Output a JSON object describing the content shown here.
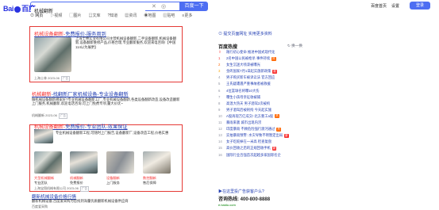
{
  "header": {
    "logo_text": "Bai",
    "logo_text2": "百度",
    "query": "机械翻新",
    "search_button": "百度一下",
    "settings": "百度首页",
    "setting_link": "设置",
    "login": "登录"
  },
  "tabs": [
    {
      "label": "网页"
    },
    {
      "label": "视频"
    },
    {
      "label": "图片"
    },
    {
      "label": "文库"
    },
    {
      "label": "知道"
    },
    {
      "label": "资讯"
    },
    {
      "label": "地图"
    },
    {
      "label": "贴吧"
    },
    {
      "label": "更多"
    }
  ],
  "info_line": "百度为您找到相关结果约100,000,000个",
  "results": {
    "r1": {
      "title_a": "机械设备翻新-",
      "title_b": "免费报价-服务周到",
      "text": "上海士林实业有限公司主营机械设备翻新,二手设备翻新,机械设备翻新,设备翻新维修产品,价格合理,专业翻新服务,欢迎来电咨询!【中国114以为展更】",
      "meta": "上海士林 2023-06",
      "ad": "广告"
    },
    "r2": {
      "title_a": "机械翻新",
      "title_b": "-找翻新厂家机械设备-专业设备翻新",
      "text": "做机械设备翻新哪家好?专业机械设备翻新工厂,专业机械设备翻新,各类设备翻新改造,设备改造翻新上门服务,机械翻新,欢迎电话咨询,可上门免费专项,量大价优~",
      "meta": "机械翻新 2023-06",
      "ad": "广告"
    },
    "r3": {
      "title_a": "机械设备翻新-",
      "title_b": "免费报价-专业团队-效果保证",
      "text": "专业机械设备翻新工程,可随时上门报告,设备翻新厂,设备改造工程,价格实惠",
      "items": [
        {
          "cap_a": "大型",
          "cap_b": "机械翻新",
          "sub": "专业团队"
        },
        {
          "cap_a": "机械",
          "cap_b": "翻新",
          "sub": "免费报价"
        },
        {
          "cap_a": "设备",
          "cap_b": "翻新",
          "sub": "上门服务"
        },
        {
          "cap_a": "数控",
          "cap_b": "翻新",
          "sub": "售后保障"
        }
      ],
      "meta": "上海宝翔机械有限公司 2023-06",
      "ad": "广告"
    },
    "r4": {
      "title": "翻新机械设备价格行情",
      "text": "翻新机械设备,百度爱采购为您找到海量优质翻新机械设备供应商",
      "meta": "百度爱采购"
    }
  },
  "right": {
    "promo_top": "提交页面网址 实用更多资料",
    "hot_title": "百度热搜",
    "refresh": "换一换",
    "hot_list": [
      {
        "idx": "",
        "text": "践行初心使命 推进中国式现代化",
        "badge": ""
      },
      {
        "idx": "1",
        "text": "2名中国公民被枪杀 事件持续",
        "badge": "热"
      },
      {
        "idx": "2",
        "text": "女生沉迷大喷漆被曝光",
        "badge": ""
      },
      {
        "idx": "3",
        "text": "金砖国家7月1日起实施新政策",
        "badge": "新"
      },
      {
        "idx": "4",
        "text": "男子购买新车被诉讼法 官方回应",
        "badge": ""
      },
      {
        "idx": "5",
        "text": "王氏疑遭遇严重事故者被救援",
        "badge": ""
      },
      {
        "idx": "6",
        "text": "4位篮球名将曝10大伤",
        "badge": ""
      },
      {
        "idx": "7",
        "text": "曝生小孩母亲征收被捕",
        "badge": ""
      },
      {
        "idx": "8",
        "text": "高温大热天 男子酒驾2次被拘",
        "badge": ""
      },
      {
        "idx": "9",
        "text": "男子酒驾后被刑拘 今天起实施",
        "badge": ""
      },
      {
        "idx": "10",
        "text": "A股再现万亿成交! 北方重工a股",
        "badge": "热"
      },
      {
        "idx": "11",
        "text": "暴雨来袭 城市出现内涝",
        "badge": ""
      },
      {
        "idx": "12",
        "text": "印度暴雨 不顾危险强行渡河通过",
        "badge": "热"
      },
      {
        "idx": "13",
        "text": "实拍暴雨预警: 水灾导致不明暂定出局",
        "badge": "新"
      },
      {
        "idx": "14",
        "text": "女子吃蛇掉在一米高 检查复盘",
        "badge": ""
      },
      {
        "idx": "15",
        "text": "高价回收之后的正规回收手机",
        "badge": "新"
      },
      {
        "idx": "16",
        "text": "国际行业百强首次超越多家国际名企",
        "badge": ""
      }
    ],
    "promo_a": "▶在这里投广告获客户么?",
    "promo_b": "咨询热线: 400-800-8888",
    "promo_c": "e.baidu.com"
  }
}
